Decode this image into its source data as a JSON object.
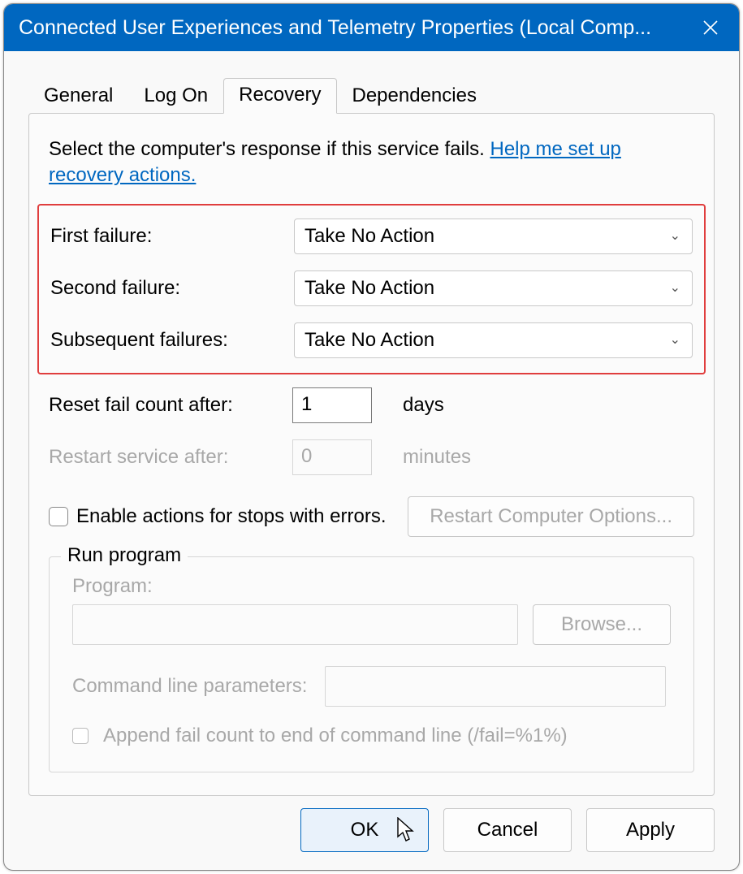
{
  "titlebar": {
    "title": "Connected User Experiences and Telemetry Properties (Local Comp..."
  },
  "tabs": {
    "general": "General",
    "logon": "Log On",
    "recovery": "Recovery",
    "dependencies": "Dependencies"
  },
  "intro": {
    "text": "Select the computer's response if this service fails. ",
    "link": "Help me set up recovery actions."
  },
  "failures": {
    "first_label": "First failure:",
    "second_label": "Second failure:",
    "subsequent_label": "Subsequent failures:",
    "first_value": "Take No Action",
    "second_value": "Take No Action",
    "subsequent_value": "Take No Action"
  },
  "reset": {
    "label": "Reset fail count after:",
    "value": "1",
    "unit": "days"
  },
  "restart": {
    "label": "Restart service after:",
    "value": "0",
    "unit": "minutes"
  },
  "enable_actions": {
    "label": "Enable actions for stops with errors.",
    "restart_options_btn": "Restart Computer Options..."
  },
  "run_program": {
    "legend": "Run program",
    "program_label": "Program:",
    "browse_btn": "Browse...",
    "cmd_label": "Command line parameters:",
    "append_label": "Append fail count to end of command line (/fail=%1%)"
  },
  "buttons": {
    "ok": "OK",
    "cancel": "Cancel",
    "apply": "Apply"
  }
}
